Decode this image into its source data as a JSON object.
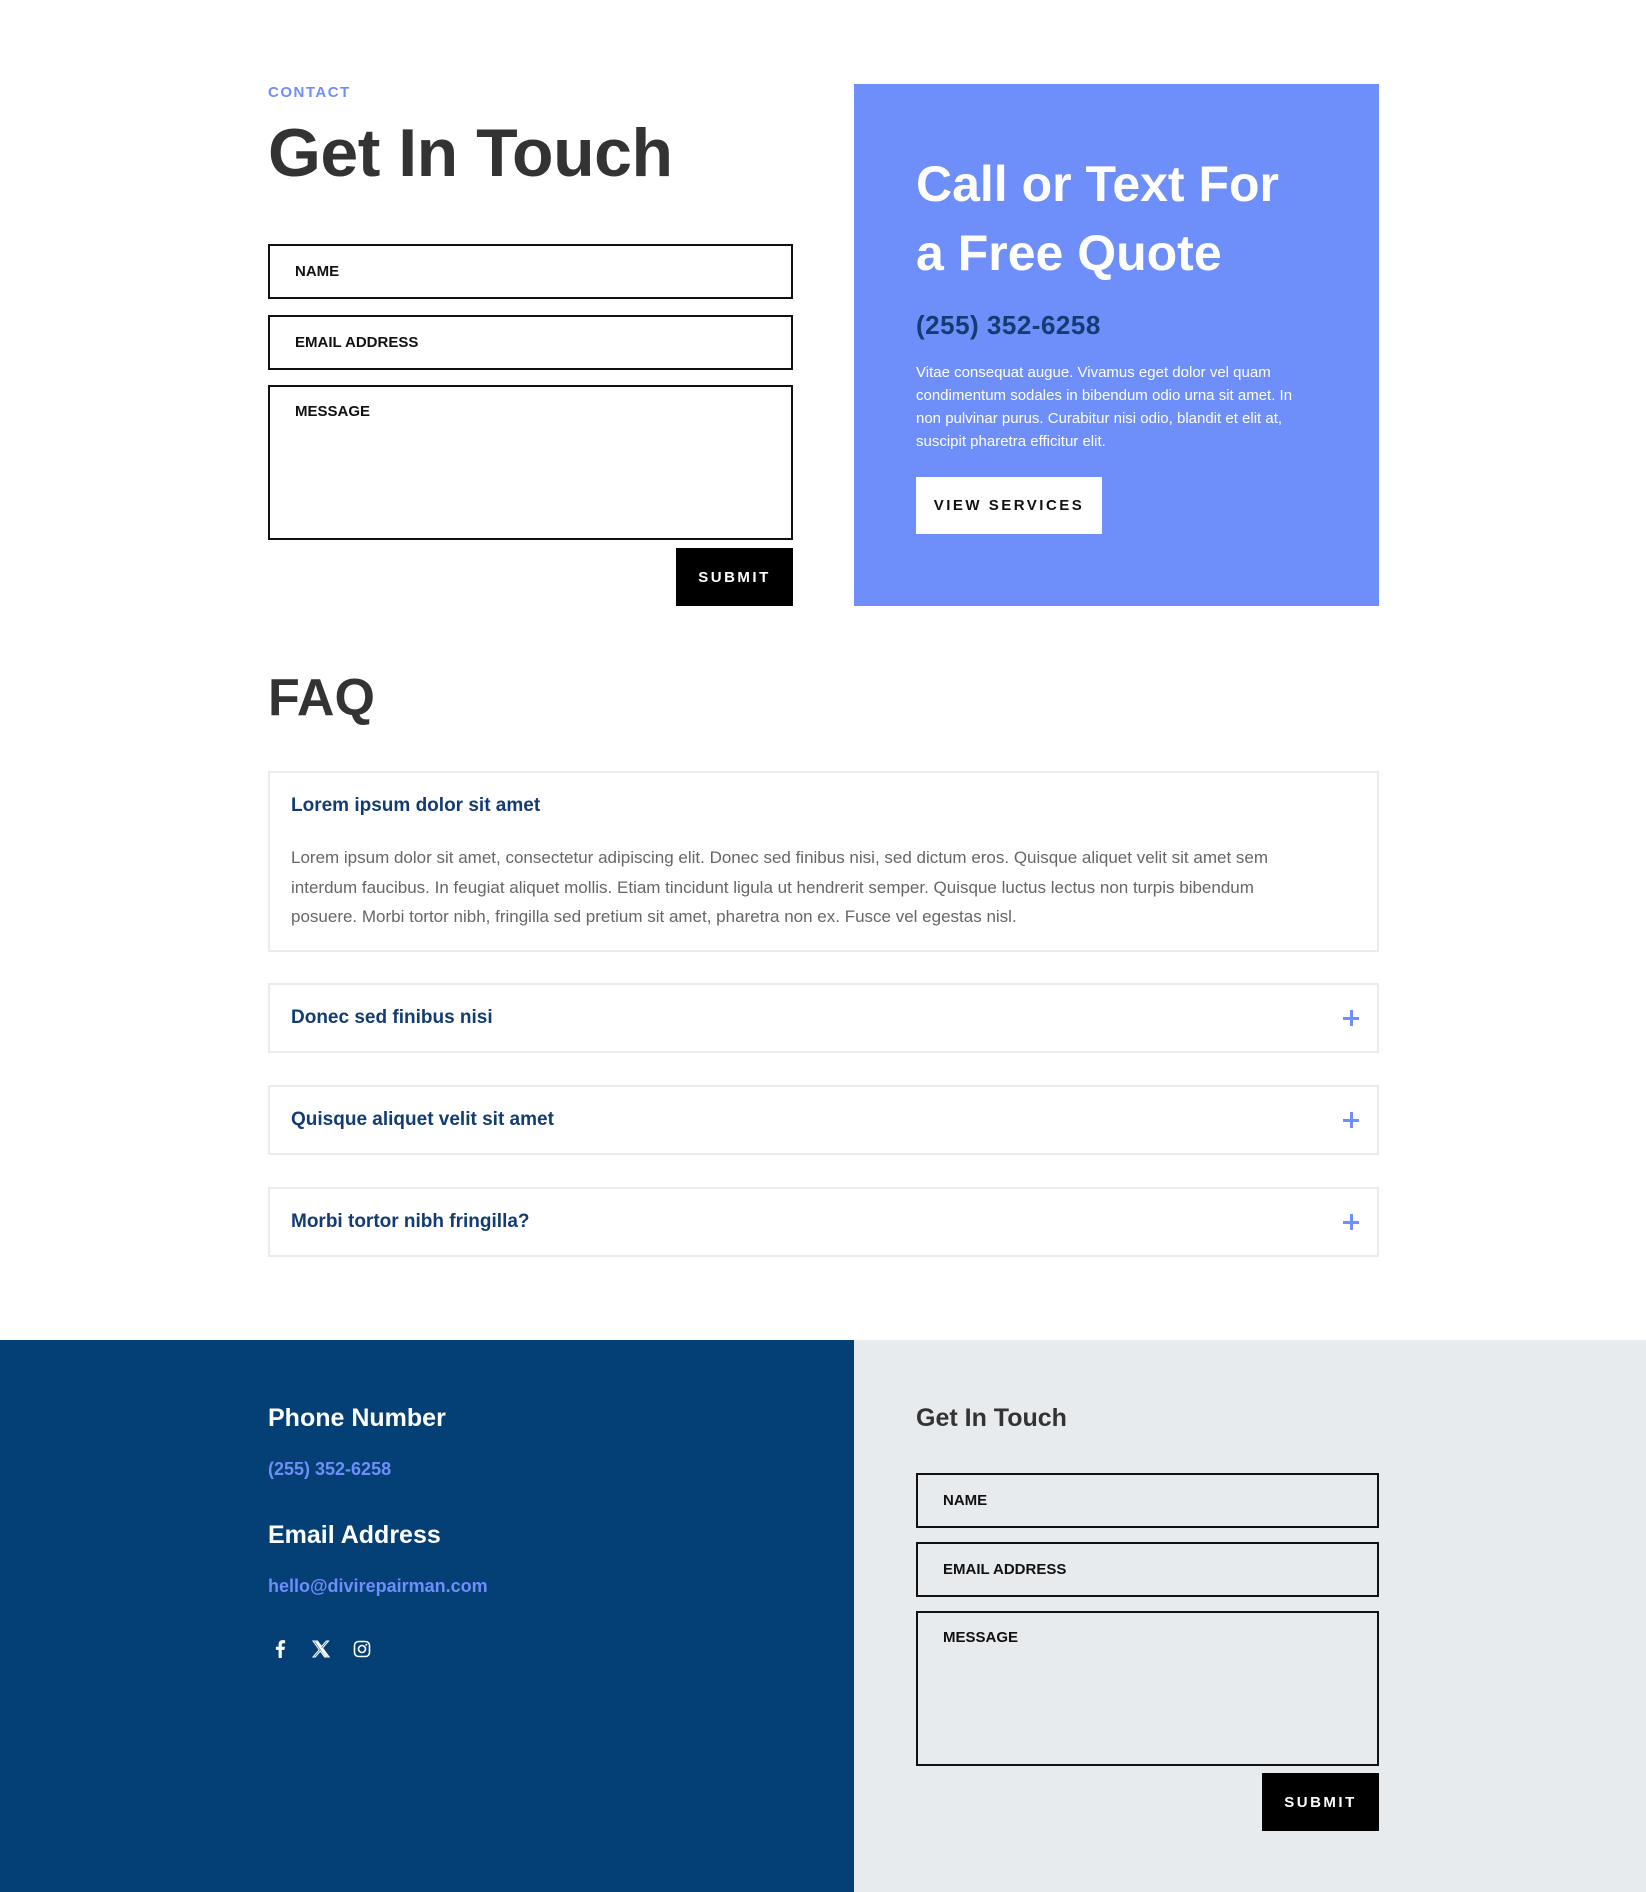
{
  "contact": {
    "eyebrow": "CONTACT",
    "title": "Get In Touch",
    "form": {
      "name_placeholder": "NAME",
      "email_placeholder": "EMAIL ADDRESS",
      "message_placeholder": "MESSAGE",
      "submit_label": "SUBMIT"
    }
  },
  "quote": {
    "title": "Call or Text For a Free Quote",
    "phone": "(255) 352-6258",
    "text": "Vitae consequat augue. Vivamus eget dolor vel quam condimentum sodales in bibendum odio urna sit amet. In non pulvinar purus. Curabitur nisi odio, blandit et elit at, suscipit pharetra efficitur elit.",
    "button_label": "VIEW SERVICES"
  },
  "faq": {
    "title": "FAQ",
    "items": [
      {
        "question": "Lorem ipsum dolor sit amet",
        "answer": "Lorem ipsum dolor sit amet, consectetur adipiscing elit. Donec sed finibus nisi, sed dictum eros. Quisque aliquet velit sit amet sem interdum faucibus. In feugiat aliquet mollis. Etiam tincidunt ligula ut hendrerit semper. Quisque luctus lectus non turpis bibendum posuere. Morbi tortor nibh, fringilla sed pretium sit amet, pharetra non ex. Fusce vel egestas nisl.",
        "expanded": true
      },
      {
        "question": "Donec sed finibus nisi",
        "expanded": false
      },
      {
        "question": "Quisque aliquet velit sit amet",
        "expanded": false
      },
      {
        "question": "Morbi tortor nibh fringilla?",
        "expanded": false
      }
    ]
  },
  "footer": {
    "phone_heading": "Phone Number",
    "phone": "(255) 352-6258",
    "email_heading": "Email Address",
    "email": "hello@divirepairman.com",
    "social_icons": [
      "facebook-icon",
      "x-icon",
      "instagram-icon"
    ],
    "form": {
      "title": "Get In Touch",
      "name_placeholder": "NAME",
      "email_placeholder": "EMAIL ADDRESS",
      "message_placeholder": "MESSAGE",
      "submit_label": "SUBMIT"
    }
  },
  "colors": {
    "accent": "#6e8ef9",
    "navy": "#043f75",
    "dark_blue_text": "#133c74",
    "light_gray_bg": "#e8ebee"
  }
}
